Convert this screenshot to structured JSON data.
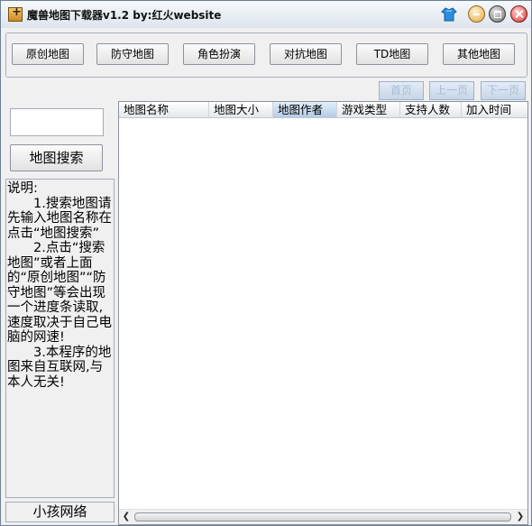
{
  "window": {
    "title": "魔兽地图下载器v1.2  by:红火website",
    "icons": [
      "app-icon",
      "skin-icon",
      "minimize-icon",
      "maximize-icon",
      "close-icon"
    ]
  },
  "categories": [
    "原创地图",
    "防守地图",
    "角色扮演",
    "对抗地图",
    "TD地图",
    "其他地图"
  ],
  "pagination": {
    "first": "首页",
    "prev": "上一页",
    "next": "下一页"
  },
  "search": {
    "value": "",
    "button": "地图搜索"
  },
  "description": {
    "heading": "说明:",
    "items": [
      "1.搜索地图请先输入地图名称在点击“地图搜索”",
      "2.点击“搜索地图”或者上面的“原创地图”“防守地图”等会出现一个进度条读取,速度取决于自己电脑的网速!",
      "3.本程序的地图来自互联网,与本人无关!"
    ]
  },
  "footer": {
    "label": "小孩网络"
  },
  "table": {
    "columns": [
      "地图名称",
      "地图大小",
      "地图作者",
      "游戏类型",
      "支持人数",
      "加入时间"
    ],
    "active_column": "地图作者",
    "rows": []
  },
  "colors": {
    "accent": "#1f5fa8",
    "page_button_text": "#a6bdd6"
  }
}
